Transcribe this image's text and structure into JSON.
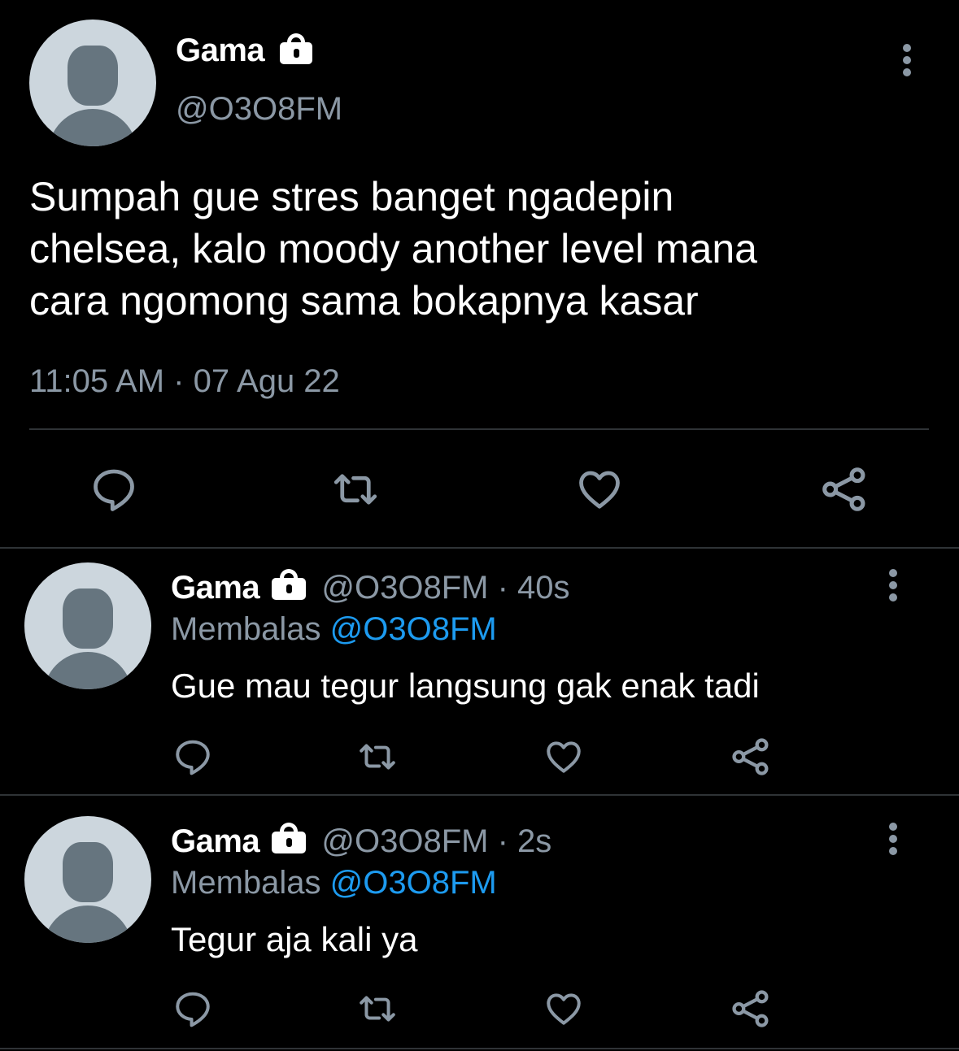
{
  "main_tweet": {
    "name": "Gama",
    "handle": "@O3O8FM",
    "text": "Sumpah gue stres banget ngadepin\nchelsea, kalo moody another level mana\ncara ngomong sama bokapnya kasar",
    "timestamp": "11:05 AM",
    "separator": "·",
    "date": "07 Agu 22",
    "icons": [
      "reply-icon",
      "retweet-icon",
      "like-icon",
      "share-icon"
    ]
  },
  "replies": [
    {
      "name": "Gama",
      "handle": "@O3O8FM",
      "time": "· 40s",
      "replying_label": "Membalas",
      "replying_to": "@O3O8FM",
      "text": "Gue mau tegur langsung gak enak tadi"
    },
    {
      "name": "Gama",
      "handle": "@O3O8FM",
      "time": "· 2s",
      "replying_label": "Membalas",
      "replying_to": "@O3O8FM",
      "text": "Tegur aja kali ya"
    }
  ],
  "colors": {
    "background": "#000000",
    "text_primary": "#ffffff",
    "text_secondary": "#8b98a5",
    "mention": "#1d9bf0",
    "divider": "#2f3336",
    "avatar_bg": "#ccd6dd",
    "avatar_figure": "#66757f"
  }
}
